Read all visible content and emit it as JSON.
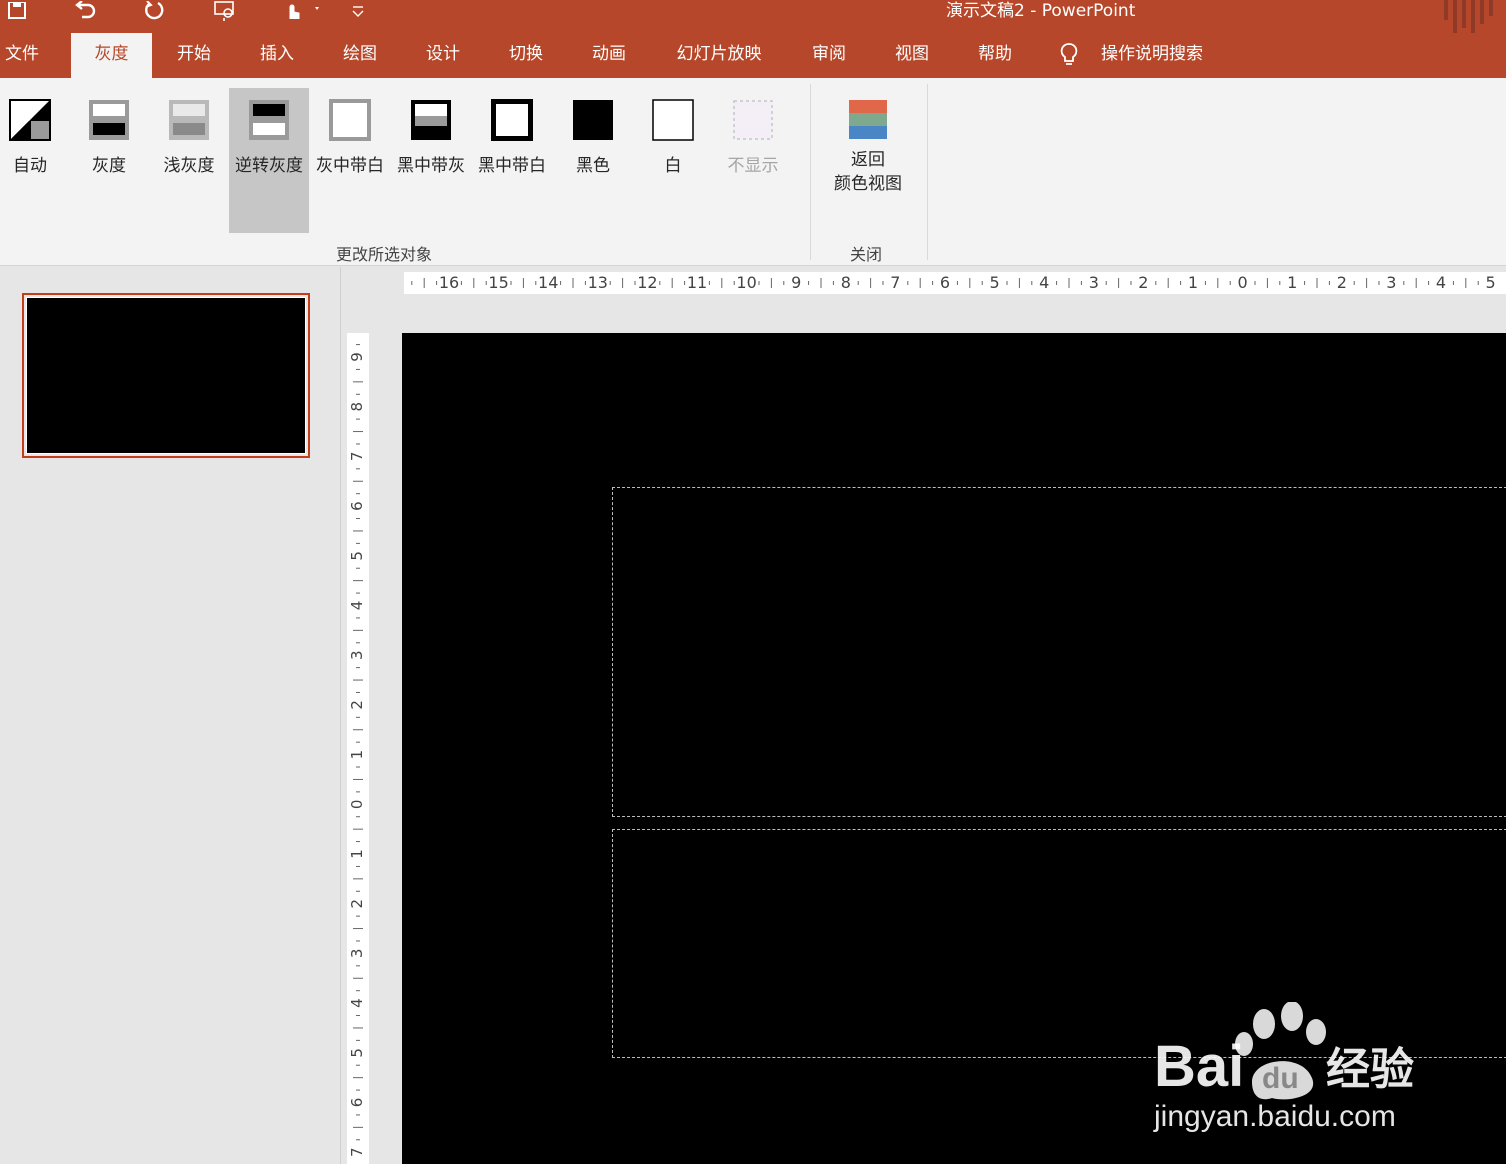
{
  "titlebar": {
    "title": "演示文稿2  -  PowerPoint",
    "qat": [
      {
        "name": "save-icon"
      },
      {
        "name": "undo-icon"
      },
      {
        "name": "redo-icon"
      },
      {
        "name": "present-from-start-icon"
      },
      {
        "name": "touch-mode-icon"
      },
      {
        "name": "customize-qat-icon"
      }
    ]
  },
  "tabs": [
    {
      "id": "file",
      "label": "文件"
    },
    {
      "id": "grayscale",
      "label": "灰度",
      "active": true
    },
    {
      "id": "home",
      "label": "开始"
    },
    {
      "id": "insert",
      "label": "插入"
    },
    {
      "id": "draw",
      "label": "绘图"
    },
    {
      "id": "design",
      "label": "设计"
    },
    {
      "id": "transitions",
      "label": "切换"
    },
    {
      "id": "animations",
      "label": "动画"
    },
    {
      "id": "slideshow",
      "label": "幻灯片放映"
    },
    {
      "id": "review",
      "label": "审阅"
    },
    {
      "id": "view",
      "label": "视图"
    },
    {
      "id": "help",
      "label": "帮助"
    },
    {
      "id": "tellme",
      "label": "操作说明搜索"
    }
  ],
  "ribbon": {
    "change_group": {
      "label": "更改所选对象",
      "buttons": [
        {
          "id": "auto",
          "label": "自动"
        },
        {
          "id": "grayscale",
          "label": "灰度"
        },
        {
          "id": "light-grayscale",
          "label": "浅灰度"
        },
        {
          "id": "inverse-grayscale",
          "label": "逆转灰度",
          "pressed": true
        },
        {
          "id": "gray-with-white-fill",
          "label": "灰中带白"
        },
        {
          "id": "black-with-grayscale-fill",
          "label": "黑中带灰"
        },
        {
          "id": "black-with-white-fill",
          "label": "黑中带白"
        },
        {
          "id": "black",
          "label": "黑色"
        },
        {
          "id": "white",
          "label": "白"
        },
        {
          "id": "dont-show",
          "label": "不显示",
          "disabled": true
        }
      ]
    },
    "close_group": {
      "label": "关闭",
      "button": {
        "line1": "返回",
        "line2": "颜色视图"
      }
    }
  },
  "slides": {
    "selected": 1,
    "count": 1
  },
  "rulers": {
    "horizontal_labels": [
      "16",
      "15",
      "14",
      "13",
      "12",
      "11",
      "10",
      "9",
      "8",
      "7",
      "6",
      "5",
      "4",
      "3",
      "2",
      "1",
      "0",
      "1",
      "2",
      "3",
      "4",
      "5"
    ],
    "vertical_labels": [
      "9",
      "8",
      "7",
      "6",
      "5",
      "4",
      "3",
      "2",
      "1",
      "0",
      "1",
      "2",
      "3",
      "4",
      "5",
      "6",
      "7"
    ]
  },
  "colors": {
    "accent": "#b7472a",
    "ribbon_bg": "#f3f3f3",
    "workspace_bg": "#e6e6e6",
    "slide_bg": "#000000",
    "placeholder_border": "#bdbdbd"
  },
  "watermark": {
    "brand": "Bai",
    "brand2": "du",
    "suffix": "经验",
    "url": "jingyan.baidu.com"
  }
}
